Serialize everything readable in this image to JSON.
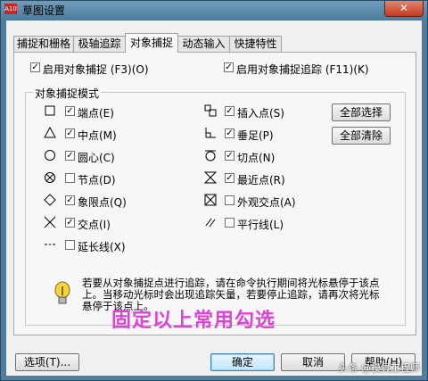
{
  "window": {
    "title": "草图设置",
    "app_icon": "A10",
    "close_glyph": "✕"
  },
  "tabs": [
    {
      "label": "捕捉和栅格",
      "active": false
    },
    {
      "label": "极轴追踪",
      "active": false
    },
    {
      "label": "对象捕捉",
      "active": true
    },
    {
      "label": "动态输入",
      "active": false
    },
    {
      "label": "快捷特性",
      "active": false
    }
  ],
  "top_options": {
    "enable_osnap": {
      "label": "启用对象捕捉 (F3)(O)",
      "checked": true
    },
    "enable_tracking": {
      "label": "启用对象捕捉追踪 (F11)(K)",
      "checked": true
    }
  },
  "group_title": "对象捕捉模式",
  "snap_modes_left": [
    {
      "label": "端点(E)",
      "checked": true,
      "icon": "endpoint-square-icon"
    },
    {
      "label": "中点(M)",
      "checked": true,
      "icon": "midpoint-triangle-icon"
    },
    {
      "label": "圆心(C)",
      "checked": true,
      "icon": "center-circle-icon"
    },
    {
      "label": "节点(D)",
      "checked": false,
      "icon": "node-icon"
    },
    {
      "label": "象限点(Q)",
      "checked": true,
      "icon": "quadrant-diamond-icon"
    },
    {
      "label": "交点(I)",
      "checked": true,
      "icon": "intersection-x-icon"
    },
    {
      "label": "延长线(X)",
      "checked": false,
      "icon": "extension-icon"
    }
  ],
  "snap_modes_right": [
    {
      "label": "插入点(S)",
      "checked": true,
      "icon": "insertion-icon"
    },
    {
      "label": "垂足(P)",
      "checked": true,
      "icon": "perpendicular-icon"
    },
    {
      "label": "切点(N)",
      "checked": true,
      "icon": "tangent-icon"
    },
    {
      "label": "最近点(R)",
      "checked": true,
      "icon": "nearest-hourglass-icon"
    },
    {
      "label": "外观交点(A)",
      "checked": false,
      "icon": "apparent-intersection-icon"
    },
    {
      "label": "平行线(L)",
      "checked": false,
      "icon": "parallel-icon"
    }
  ],
  "buttons": {
    "select_all": "全部选择",
    "clear_all": "全部清除",
    "options": "选项(T)...",
    "ok": "确定",
    "cancel": "取消",
    "help": "帮助(H)"
  },
  "note": "若要从对象捕捉点进行追踪，请在命令执行期间将光标悬停于该点上。当移动光标时会出现追踪矢量，若要停止追踪，请再次将光标悬停于该点上。",
  "overlay_text": "固定以上常用勾选",
  "watermark": "头条 @模具工程师",
  "colors": {
    "title_bar": "#4f7f9f",
    "overlay": "#e040d8",
    "panel": "#f7f7f7"
  }
}
